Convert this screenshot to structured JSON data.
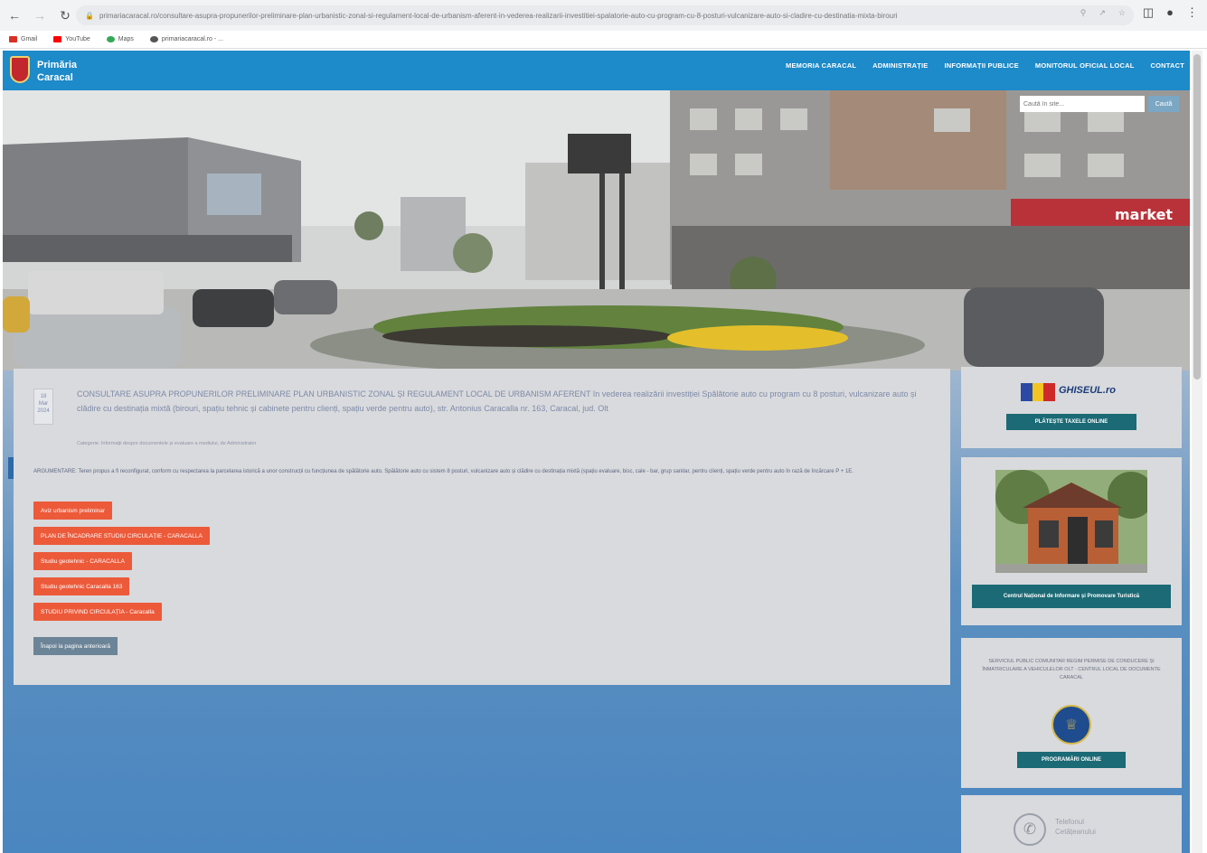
{
  "browser": {
    "url": "primariacaracal.ro/consultare-asupra-propunerilor-preliminare-plan-urbanistic-zonal-si-regulament-local-de-urbanism-aferent-in-vederea-realizarii-investitiei-spalatorie-auto-cu-program-cu-8-posturi-vulcanizare-auto-si-cladire-cu-destinatia-mixta-birouri",
    "bookmarks": [
      {
        "label": "Gmail",
        "color": "#d93025"
      },
      {
        "label": "YouTube",
        "color": "#ff0000"
      },
      {
        "label": "Maps",
        "color": "#34a853"
      },
      {
        "label": "primariacaracal.ro - ...",
        "color": "#555555"
      }
    ]
  },
  "header": {
    "brand_line1": "Primăria",
    "brand_line2": "Caracal",
    "nav": [
      "MEMORIA CARACAL",
      "ADMINISTRAȚIE",
      "INFORMAȚII PUBLICE",
      "MONITORUL OFICIAL LOCAL",
      "CONTACT"
    ]
  },
  "search": {
    "placeholder": "Caută în site...",
    "button": "Caută"
  },
  "hero": {
    "storefront_sign": "market"
  },
  "article": {
    "date_day": "18",
    "date_month": "Mar",
    "date_year": "2024",
    "title": "CONSULTARE ASUPRA PROPUNERILOR PRELIMINARE PLAN URBANISTIC ZONAL ȘI REGULAMENT LOCAL DE URBANISM AFERENT",
    "title_rest": " în vederea realizării investiției Spălătorie auto cu program cu 8 posturi, vulcanizare auto și clădire cu destinația mixtă (birouri, spațiu tehnic și cabinete pentru clienți, spațiu verde pentru auto), str. Antonius Caracalla nr. 163, Caracal, jud. Olt",
    "meta": "Categorie: Informații despre documentele și evaluare a mediului, de Administrator",
    "body": "ARGUMENTARE: Teren propus a fi reconfigurat, conform cu respectarea la parcelarea istorică a unor construcții cu funcțiunea de spălătorie auto. Spălătorie auto cu sistem 8 posturi, vulcanizare auto și clădire cu destinația mixtă (spațiu evaluare, bisc, cale - bar, grup sanitar, pentru clienți, spațiu verde pentru auto în rază de încărcare P + 1E.",
    "buttons": [
      "Aviz urbanism preliminar",
      "PLAN DE ÎNCADRARE STUDIU CIRCULAȚIE - CARACALLA",
      "Studiu geotehnic - CARACALLA",
      "Studiu geotehnic Caracalla 163",
      "STUDIU PRIVIND CIRCULAȚIA - Caracalla"
    ],
    "back_button": "Înapoi la pagina anterioară"
  },
  "sidebar": {
    "ghiseul_logo": "GHISEUL.ro",
    "ghiseul_button": "PLĂTEȘTE TAXELE ONLINE",
    "tourism_button": "Centrul Național de Informare și Promovare Turistică",
    "service_text": "SERVICIUL PUBLIC COMUNITAR REGIM PERMISE DE CONDUCERE ȘI ÎNMATRICULARE A VEHICULELOR OLT - CENTRUL LOCAL DE DOCUMENTE CARACAL",
    "service_button": "PROGRAMĂRI ONLINE",
    "phone_line1": "Telefonul",
    "phone_line2": "Cetățeanului"
  },
  "colors": {
    "header_blue": "#1d8ac9",
    "orange_button": "#ec5a3a",
    "teal_button": "#1b6a75"
  }
}
